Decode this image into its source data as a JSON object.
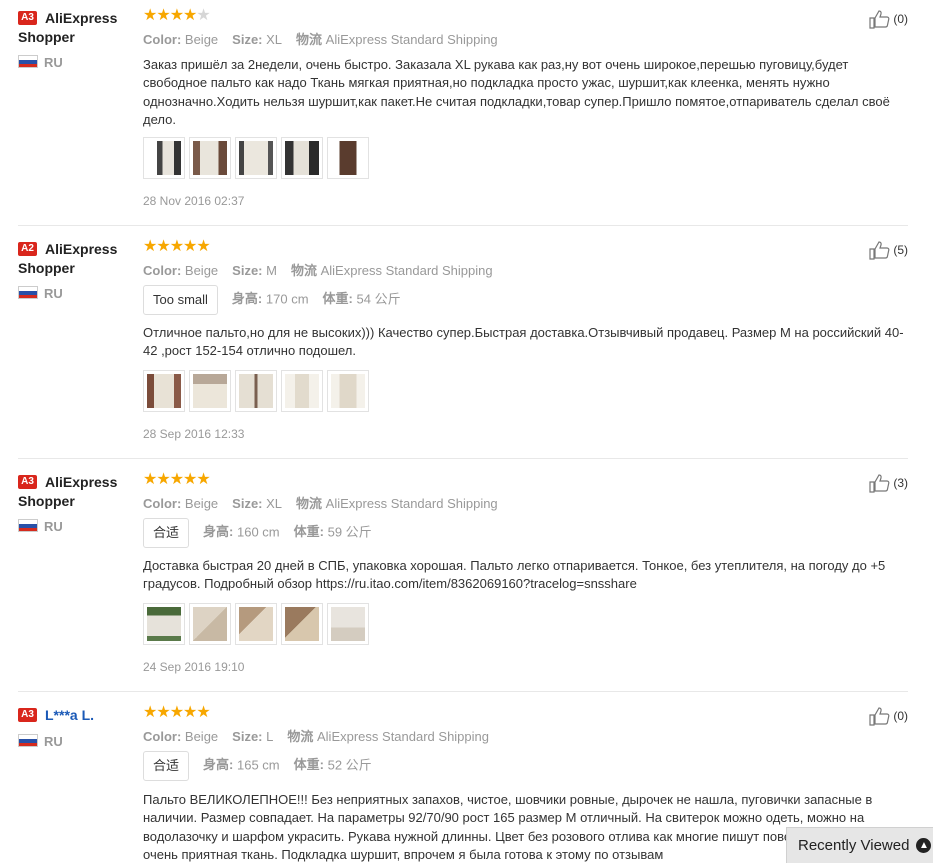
{
  "reviews": [
    {
      "badge": "A3",
      "name_line1": "AliExpress",
      "name_line2": "Shopper",
      "country": "RU",
      "stars": 4,
      "color_label": "Color:",
      "color_value": "Beige",
      "size_label": "Size:",
      "size_value": "XL",
      "ship_label": "物流",
      "ship_value": "AliExpress Standard Shipping",
      "text": "Заказ пришёл за 2недели, очень быстро. Заказала XL рукава как раз,ну вот очень широкое,перешью пуговицу,будет свободное пальто как надо Ткань мягкая приятная,но подкладка просто ужас, шуршит,как клеенка, менять нужно однозначно.Ходить нельзя шуршит,как пакет.Не считая подкладки,товар супер.Пришло помятое,отпариватель сделал своё дело.",
      "date": "28 Nov 2016 02:37",
      "helpful": "(0)"
    },
    {
      "badge": "A2",
      "name_line1": "AliExpress",
      "name_line2": "Shopper",
      "country": "RU",
      "stars": 5,
      "color_label": "Color:",
      "color_value": "Beige",
      "size_label": "Size:",
      "size_value": "M",
      "ship_label": "物流",
      "ship_value": "AliExpress Standard Shipping",
      "fit": "Too small",
      "height_label": "身高:",
      "height_value": "170 cm",
      "weight_label": "体重:",
      "weight_value": "54 公斤",
      "text": "Отличное пальто,но для не высоких))) Качество супер.Быстрая доставка.Отзывчивый продавец. Размер М на российский 40-42 ,рост 152-154 отлично подошел.",
      "date": "28 Sep 2016 12:33",
      "helpful": "(5)"
    },
    {
      "badge": "A3",
      "name_line1": "AliExpress",
      "name_line2": "Shopper",
      "country": "RU",
      "stars": 5,
      "color_label": "Color:",
      "color_value": "Beige",
      "size_label": "Size:",
      "size_value": "XL",
      "ship_label": "物流",
      "ship_value": "AliExpress Standard Shipping",
      "fit": "合适",
      "height_label": "身高:",
      "height_value": "160 cm",
      "weight_label": "体重:",
      "weight_value": "59 公斤",
      "text": "Доставка быстрая 20 дней в СПБ, упаковка хорошая. Пальто легко отпаривается. Тонкое, без утеплителя, на погоду до +5 градусов. Подробный обзор https://ru.itao.com/item/8362069160?tracelog=snsshare",
      "date": "24 Sep 2016 19:10",
      "helpful": "(3)"
    },
    {
      "badge": "A3",
      "name_line1": "L***a L.",
      "country": "RU",
      "stars": 5,
      "color_label": "Color:",
      "color_value": "Beige",
      "size_label": "Size:",
      "size_value": "L",
      "ship_label": "物流",
      "ship_value": "AliExpress Standard Shipping",
      "fit": "合适",
      "height_label": "身高:",
      "height_value": "165 cm",
      "weight_label": "体重:",
      "weight_value": "52 公斤",
      "text": "Пальто ВЕЛИКОЛЕПНОЕ!!! Без неприятных запахов, чистое, шовчики ровные, дырочек не нашла, пуговички запасные в наличии. Размер совпадает. На параметры 92/70/90 рост 165 размер М отличный. На свитерок можно одеть, можно на водолазочку и шарфом украсить. Рукава нужной длинны. Цвет без розового отлива как многие пишут повезло). На ощупь очень приятная ткань. Подкладка шуршит, впрочем я была готова к этому по отзывам",
      "helpful": "(0)"
    }
  ],
  "recently_viewed": "Recently Viewed",
  "colors": {
    "star": "#f7a700",
    "badge": "#d9261c",
    "link": "#1a59b7"
  }
}
